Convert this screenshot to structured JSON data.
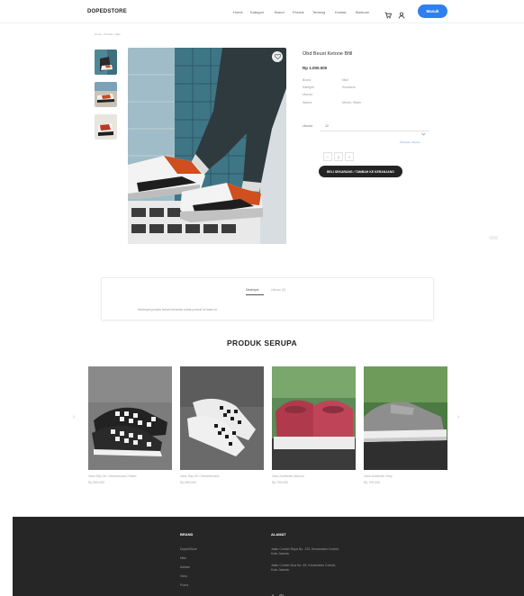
{
  "nav": {
    "logo": "DOPEDSTORE",
    "links": [
      "Home",
      "Kategori",
      "Brand",
      "Produk",
      "Tentang",
      "Kontak",
      "Bantuan"
    ],
    "login_button": "Masuk",
    "accent_color": "#2f80ed",
    "icons": [
      "cart-icon",
      "user-icon"
    ]
  },
  "breadcrumb": "Home › Produk › Nike",
  "product": {
    "title": "Obd Beust Ketone Bfill",
    "price": "Rp 1.000.000",
    "specs": [
      {
        "key": "Brand",
        "value": "Nike"
      },
      {
        "key": "Kategori",
        "value": "Sneakers"
      },
      {
        "key": "Ukuran",
        "value": ""
      },
      {
        "key": "Warna",
        "value": "Merah, Hitam"
      }
    ],
    "size_label": "Ukuran",
    "size_value": "42",
    "size_guide": "Panduan Ukuran",
    "quantity": "1",
    "buy_button": "BELI SEKARANG / TAMBAH KE KERANJANG"
  },
  "description": {
    "tabs": [
      "Deskripsi",
      "Ulasan (0)"
    ],
    "text": "Deskripsi produk belum tersedia untuk produk ini saat ini."
  },
  "related": {
    "title": "PRODUK SERUPA",
    "items": [
      {
        "name": "Vans Slip-On Checkerboard Hitam",
        "price": "Rp 899.000"
      },
      {
        "name": "Vans Slip-On Checkerboard",
        "price": "Rp 899.000"
      },
      {
        "name": "Vans Authentic Maroon",
        "price": "Rp 799.000"
      },
      {
        "name": "Vans Authentic Grey",
        "price": "Rp 799.000"
      }
    ]
  },
  "footer": {
    "col1_title": "BRAND",
    "col1_links": [
      "DopedStore",
      "Nike",
      "Adidas",
      "Vans",
      "Puma"
    ],
    "col2_title": "ALAMAT",
    "col2_lines": [
      "Jalan Contoh Raya No. 123, Kecamatan Contoh, Kota Jakarta",
      "Jalan Contoh Dua No. 45, Kecamatan Contoh, Kota Jakarta"
    ]
  }
}
